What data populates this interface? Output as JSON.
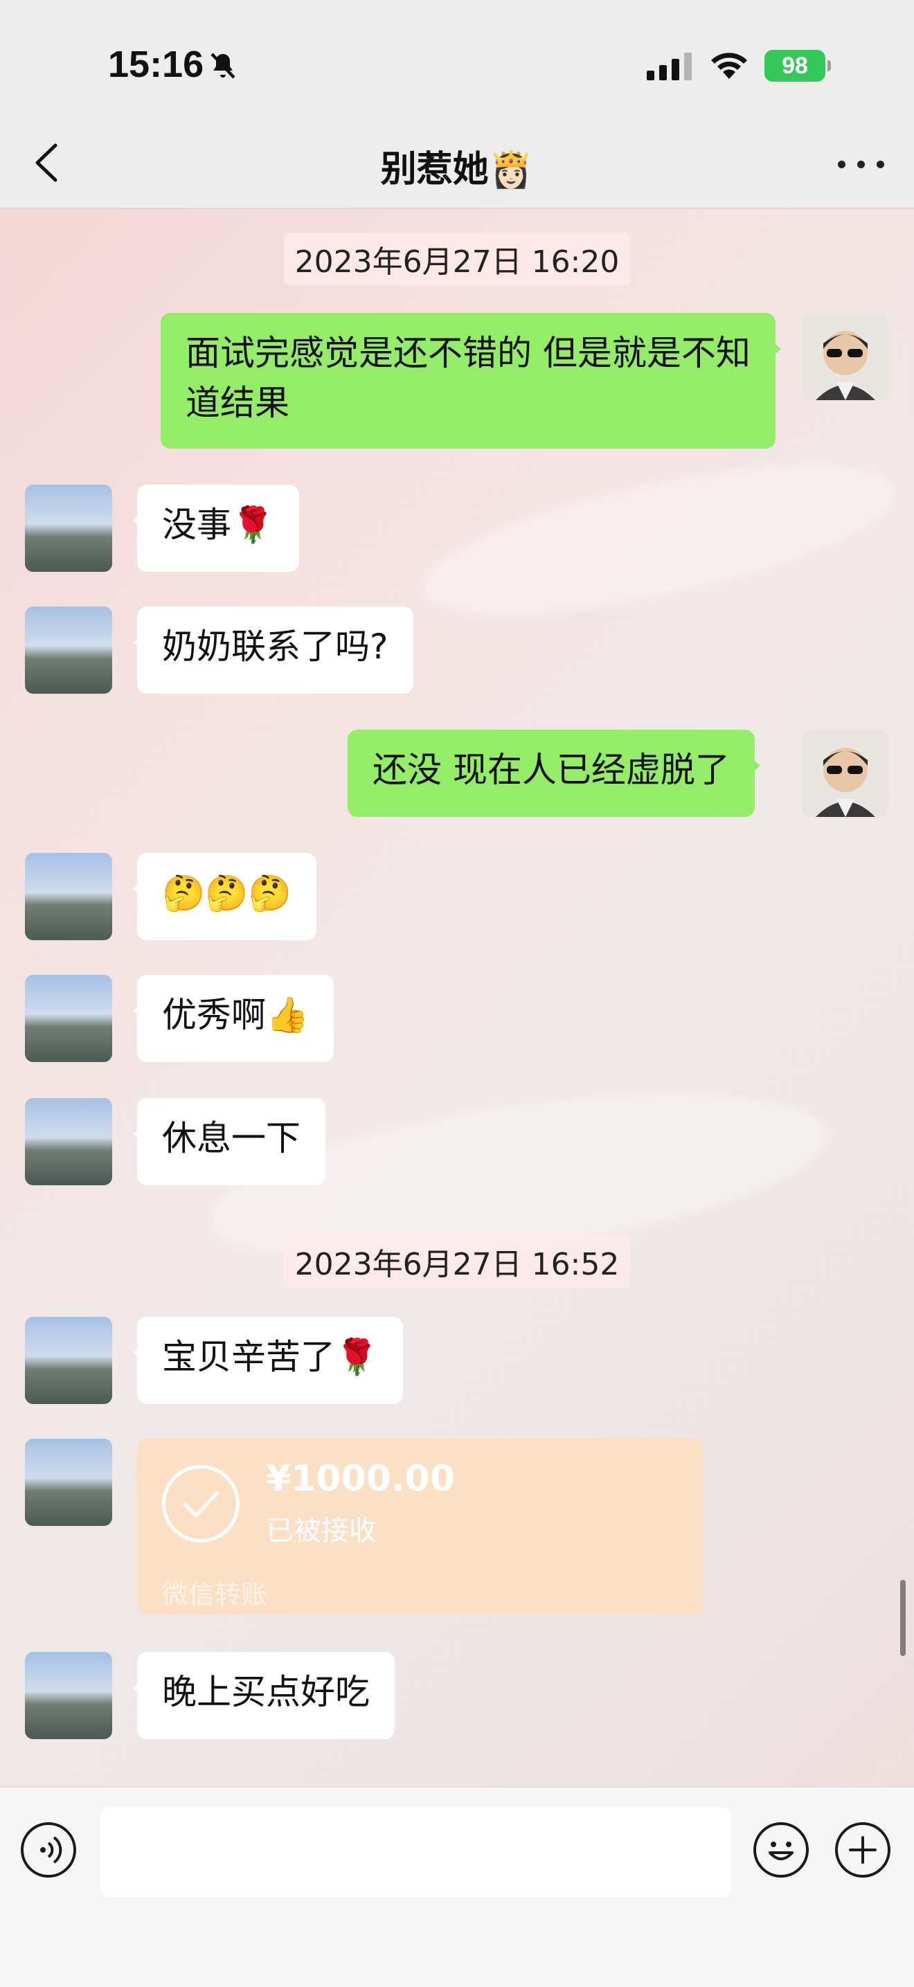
{
  "status_bar": {
    "time": "15:16",
    "battery": "98"
  },
  "nav": {
    "title": "别惹她👸🏻"
  },
  "messages": {
    "ts1": "2023年6月27日 16:20",
    "m1": "面试完感觉是还不错的 但是就是不知道结果",
    "m2": "没事🌹",
    "m3": "奶奶联系了吗?",
    "m4": "还没 现在人已经虚脱了",
    "m5": "🤔🤔🤔",
    "m6": "优秀啊👍",
    "m7": "休息一下",
    "ts2": "2023年6月27日 16:52",
    "m8": "宝贝辛苦了🌹",
    "m10": "晚上买点好吃"
  },
  "transfer": {
    "amount": "¥1000.00",
    "status": "已被接收",
    "label": "微信转账"
  },
  "input": {
    "value": ""
  },
  "colors": {
    "sent_bubble": "#95ec69",
    "received_bubble": "#ffffff",
    "transfer_bg": "#fbe0c6",
    "battery": "#34c759"
  }
}
